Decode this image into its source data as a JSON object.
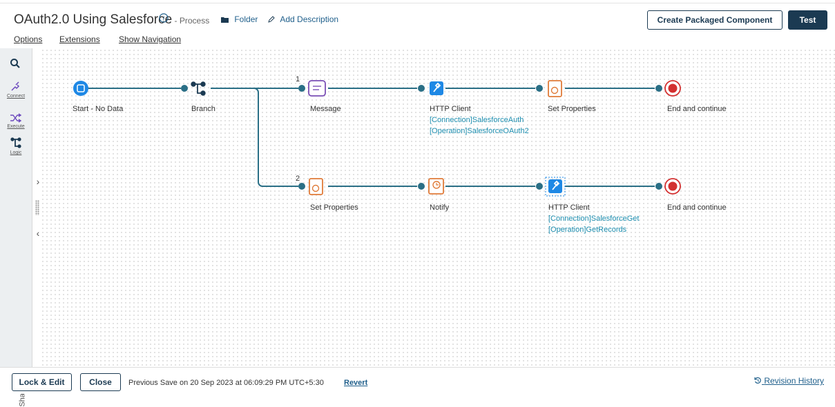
{
  "header": {
    "title": "OAuth2.0 Using Salesforce",
    "subtitle": " - Process",
    "folder_label": "Folder",
    "add_description_label": "Add Description",
    "create_button": "Create Packaged Component",
    "test_button": "Test"
  },
  "menu": [
    "Options",
    "Extensions",
    "Show Navigation"
  ],
  "left_panel": {
    "items": [
      {
        "label": "Connect",
        "icon": "connect-icon"
      },
      {
        "label": "Execute",
        "icon": "execute-icon"
      },
      {
        "label": "Logic",
        "icon": "logic-icon"
      }
    ],
    "search_icon": "search-icon",
    "shapes_label": "Shapes"
  },
  "canvas": {
    "branch_numbers": [
      "1",
      "2"
    ],
    "nodes": [
      {
        "id": "start",
        "label": "Start - No Data",
        "icon": "start-icon"
      },
      {
        "id": "branch",
        "label": "Branch",
        "icon": "branch-icon"
      },
      {
        "id": "message",
        "label": "Message",
        "icon": "message-icon"
      },
      {
        "id": "http1",
        "label": "HTTP Client",
        "sub1": "[Connection]SalesforceAuth",
        "sub2": "[Operation]SalesforceOAuth2",
        "icon": "connector-icon"
      },
      {
        "id": "setprops1",
        "label": "Set Properties",
        "icon": "set-properties-icon"
      },
      {
        "id": "end1",
        "label": "End and continue",
        "icon": "stop-icon"
      },
      {
        "id": "setprops2",
        "label": "Set Properties",
        "icon": "set-properties-icon"
      },
      {
        "id": "notify",
        "label": "Notify",
        "icon": "notify-icon"
      },
      {
        "id": "http2",
        "label": "HTTP Client",
        "sub1": "[Connection]SalesforceGet",
        "sub2": "[Operation]GetRecords",
        "icon": "connector-icon"
      },
      {
        "id": "end2",
        "label": "End and continue",
        "icon": "stop-icon"
      }
    ],
    "colors": {
      "line": "#2a6f86",
      "accent": "#1e88e5",
      "orange": "#e07b39",
      "purple": "#7a4fb5",
      "red": "#d32f2f"
    }
  },
  "footer": {
    "lock_edit": "Lock & Edit",
    "close": "Close",
    "save_info": "Previous Save on 20 Sep 2023 at 06:09:29 PM UTC+5:30",
    "revert": "Revert",
    "revision_history": "Revision History"
  }
}
